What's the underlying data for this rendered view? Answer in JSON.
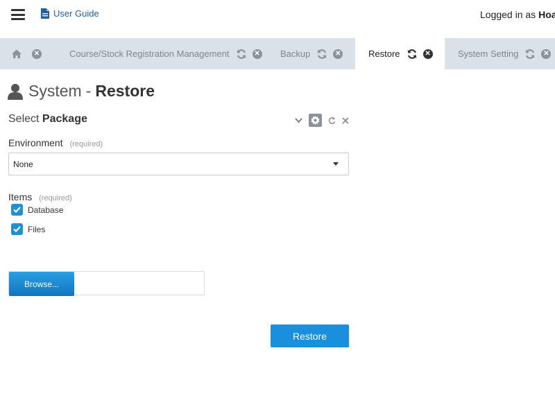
{
  "header": {
    "user_guide_label": "User Guide",
    "logged_in_prefix": "Logged in as",
    "user_name": "Hoa"
  },
  "tabs": [
    {
      "label": "",
      "icon": "home-icon",
      "active": false
    },
    {
      "label": "Course/Stock Registration Management",
      "active": false
    },
    {
      "label": "Backup",
      "active": false
    },
    {
      "label": "Restore",
      "active": true
    },
    {
      "label": "System Setting",
      "active": false
    }
  ],
  "page": {
    "title_prefix": "System",
    "title_sep": "-",
    "title_main": "Restore"
  },
  "widget": {
    "title_prefix": "Select",
    "title_main": "Package"
  },
  "form": {
    "environment_label": "Environment",
    "environment_required": "(required)",
    "environment_value": "None",
    "items_label": "Items",
    "items_required": "(required)",
    "items": [
      {
        "label": "Database",
        "checked": true
      },
      {
        "label": "Files",
        "checked": true
      }
    ],
    "browse_label": "Browse...",
    "file_name": "",
    "restore_label": "Restore"
  },
  "colors": {
    "accent": "#1a8fdd",
    "tab_strip": "#dbe1e8",
    "link": "#1f5fa8"
  }
}
